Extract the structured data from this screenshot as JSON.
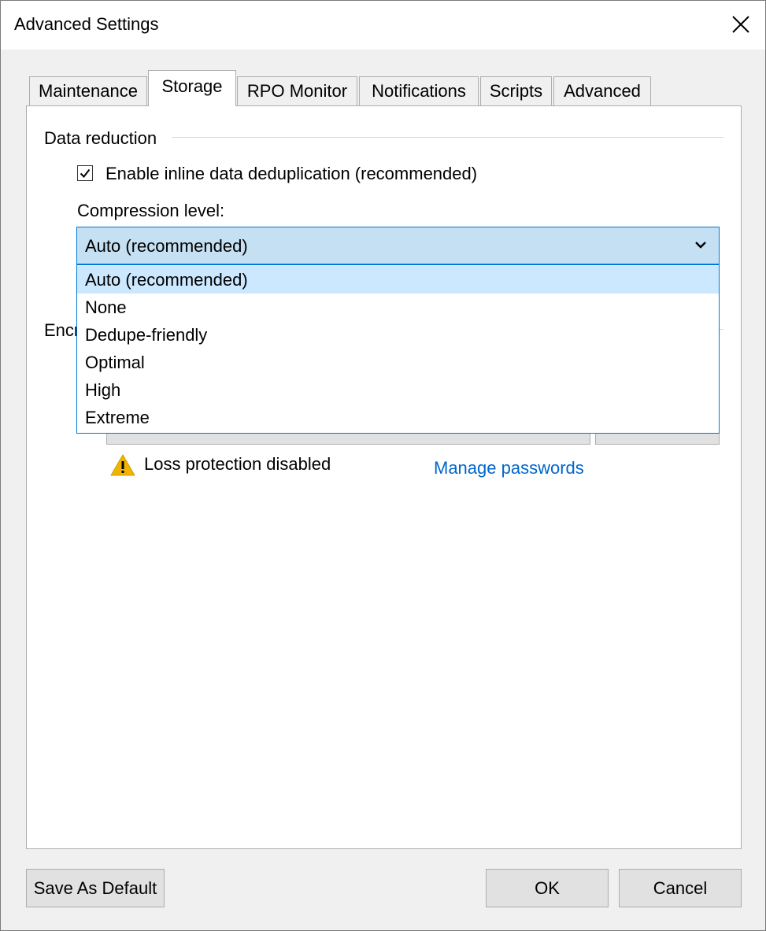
{
  "window": {
    "title": "Advanced Settings"
  },
  "tabs": [
    "Maintenance",
    "Storage",
    "RPO Monitor",
    "Notifications",
    "Scripts",
    "Advanced"
  ],
  "active_tab": "Storage",
  "data_reduction": {
    "group_label": "Data reduction",
    "dedup_checkbox": {
      "label": "Enable inline data deduplication (recommended)",
      "checked": true
    },
    "compression": {
      "label": "Compression level:",
      "selected": "Auto (recommended)",
      "options": [
        "Auto (recommended)",
        "None",
        "Dedupe-friendly",
        "Optimal",
        "High",
        "Extreme"
      ]
    }
  },
  "encryption": {
    "group_label_partial": "Encr",
    "warning": "Loss protection disabled",
    "manage_link": "Manage passwords"
  },
  "footer": {
    "save_default": "Save As Default",
    "ok": "OK",
    "cancel": "Cancel"
  },
  "colors": {
    "accent": "#0078d7",
    "combo_bg": "#c5e0f2",
    "highlight": "#cce8ff",
    "link": "#0066cc",
    "warning": "#f0b400"
  }
}
